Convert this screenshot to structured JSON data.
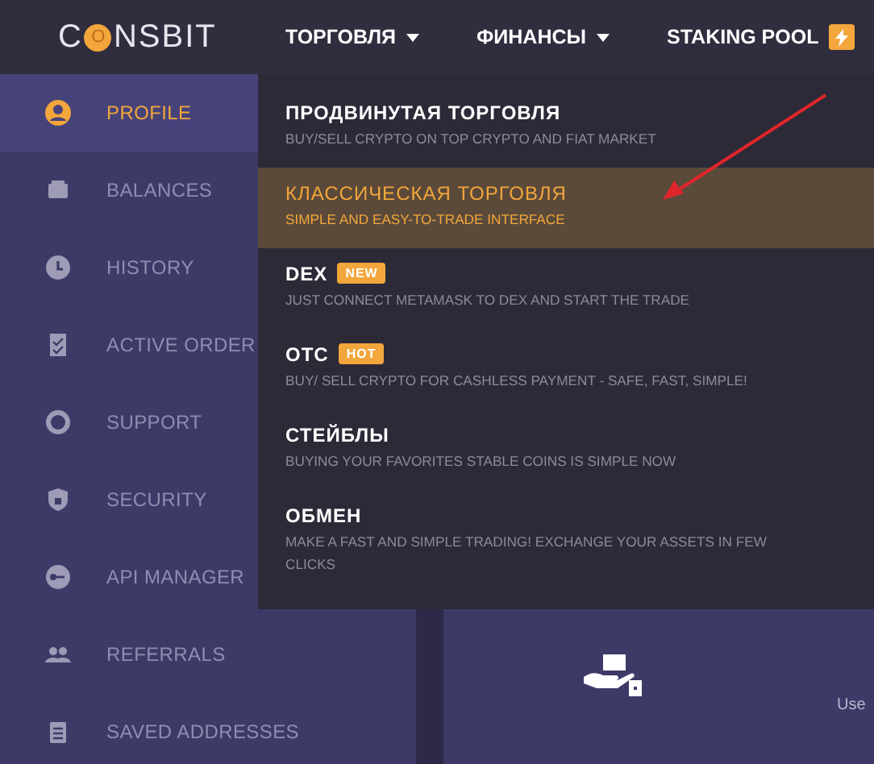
{
  "navbar": {
    "logo": "CONSBIT",
    "menu": [
      {
        "label": "ТОРГОВЛЯ",
        "kind": "dropdown"
      },
      {
        "label": "ФИНАНСЫ",
        "kind": "dropdown"
      },
      {
        "label": "STAKING POOL",
        "kind": "bolt"
      }
    ]
  },
  "sidebar": {
    "items": [
      {
        "label": "PROFILE",
        "selected": true
      },
      {
        "label": "BALANCES",
        "selected": false
      },
      {
        "label": "HISTORY",
        "selected": false
      },
      {
        "label": "ACTIVE ORDER",
        "selected": false
      },
      {
        "label": "SUPPORT",
        "selected": false
      },
      {
        "label": "SECURITY",
        "selected": false
      },
      {
        "label": "API MANAGER",
        "selected": false
      },
      {
        "label": "REFERRALS",
        "selected": false
      },
      {
        "label": "SAVED ADDRESSES",
        "selected": false
      }
    ]
  },
  "trade_menu": {
    "items": [
      {
        "title": "ПРОДВИНУТАЯ ТОРГОВЛЯ",
        "subtitle": "BUY/SELL CRYPTO ON TOP CRYPTO AND FIAT MARKET",
        "selected": false
      },
      {
        "title": "КЛАССИЧЕСКАЯ ТОРГОВЛЯ",
        "subtitle": "SIMPLE AND EASY-TO-TRADE INTERFACE",
        "selected": true
      },
      {
        "title": "DEX",
        "badge": "NEW",
        "subtitle": "JUST CONNECT METAMASK TO DEX AND START THE TRADE",
        "selected": false
      },
      {
        "title": "OTC",
        "badge": "HOT",
        "subtitle": "BUY/ SELL CRYPTO FOR CASHLESS PAYMENT - SAFE, FAST, SIMPLE!",
        "selected": false
      },
      {
        "title": "СТЕЙБЛЫ",
        "subtitle": "BUYING YOUR FAVORITES STABLE COINS IS SIMPLE NOW",
        "selected": false
      },
      {
        "title": "ОБМЕН",
        "subtitle": "MAKE A FAST AND SIMPLE TRADING! EXCHANGE YOUR ASSETS IN FEW CLICKS",
        "selected": false
      }
    ]
  },
  "content": {
    "stat_label": "Use"
  }
}
